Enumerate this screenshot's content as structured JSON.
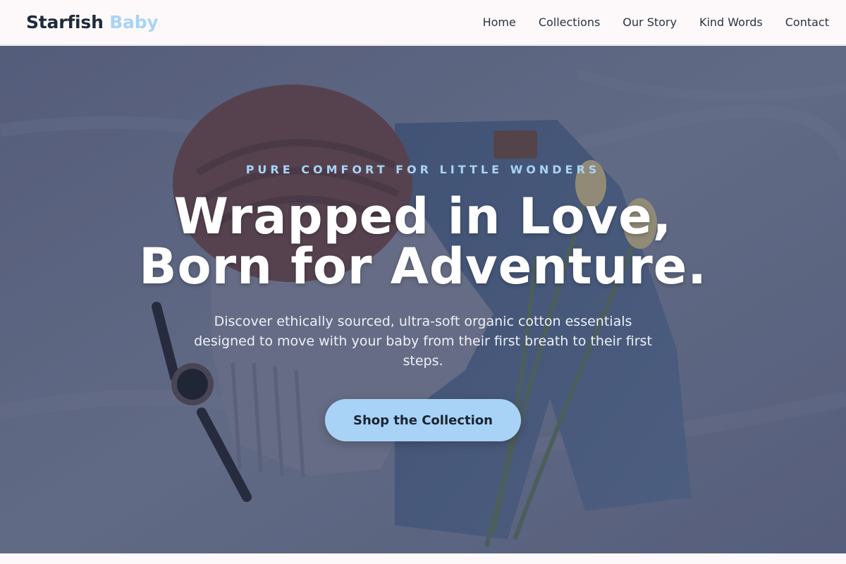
{
  "header": {
    "brand_main": "Starfish",
    "brand_accent": "Baby",
    "nav": [
      "Home",
      "Collections",
      "Our Story",
      "Kind Words",
      "Contact"
    ]
  },
  "hero": {
    "eyebrow": "PURE COMFORT FOR LITTLE WONDERS",
    "headline_line1": "Wrapped in Love,",
    "headline_line2": "Born for Adventure.",
    "subtext": "Discover ethically sourced, ultra-soft organic cotton essentials designed to move with your baby from their first breath to their first steps.",
    "cta_label": "Shop the Collection",
    "background_image": "knit beanie, sweater, denim jeans, wristwatch and tulips laid flat on bed sheet"
  },
  "colors": {
    "accent": "#a9d3f6",
    "text_dark": "#1f2a3a",
    "header_bg": "#fdf9fa"
  }
}
